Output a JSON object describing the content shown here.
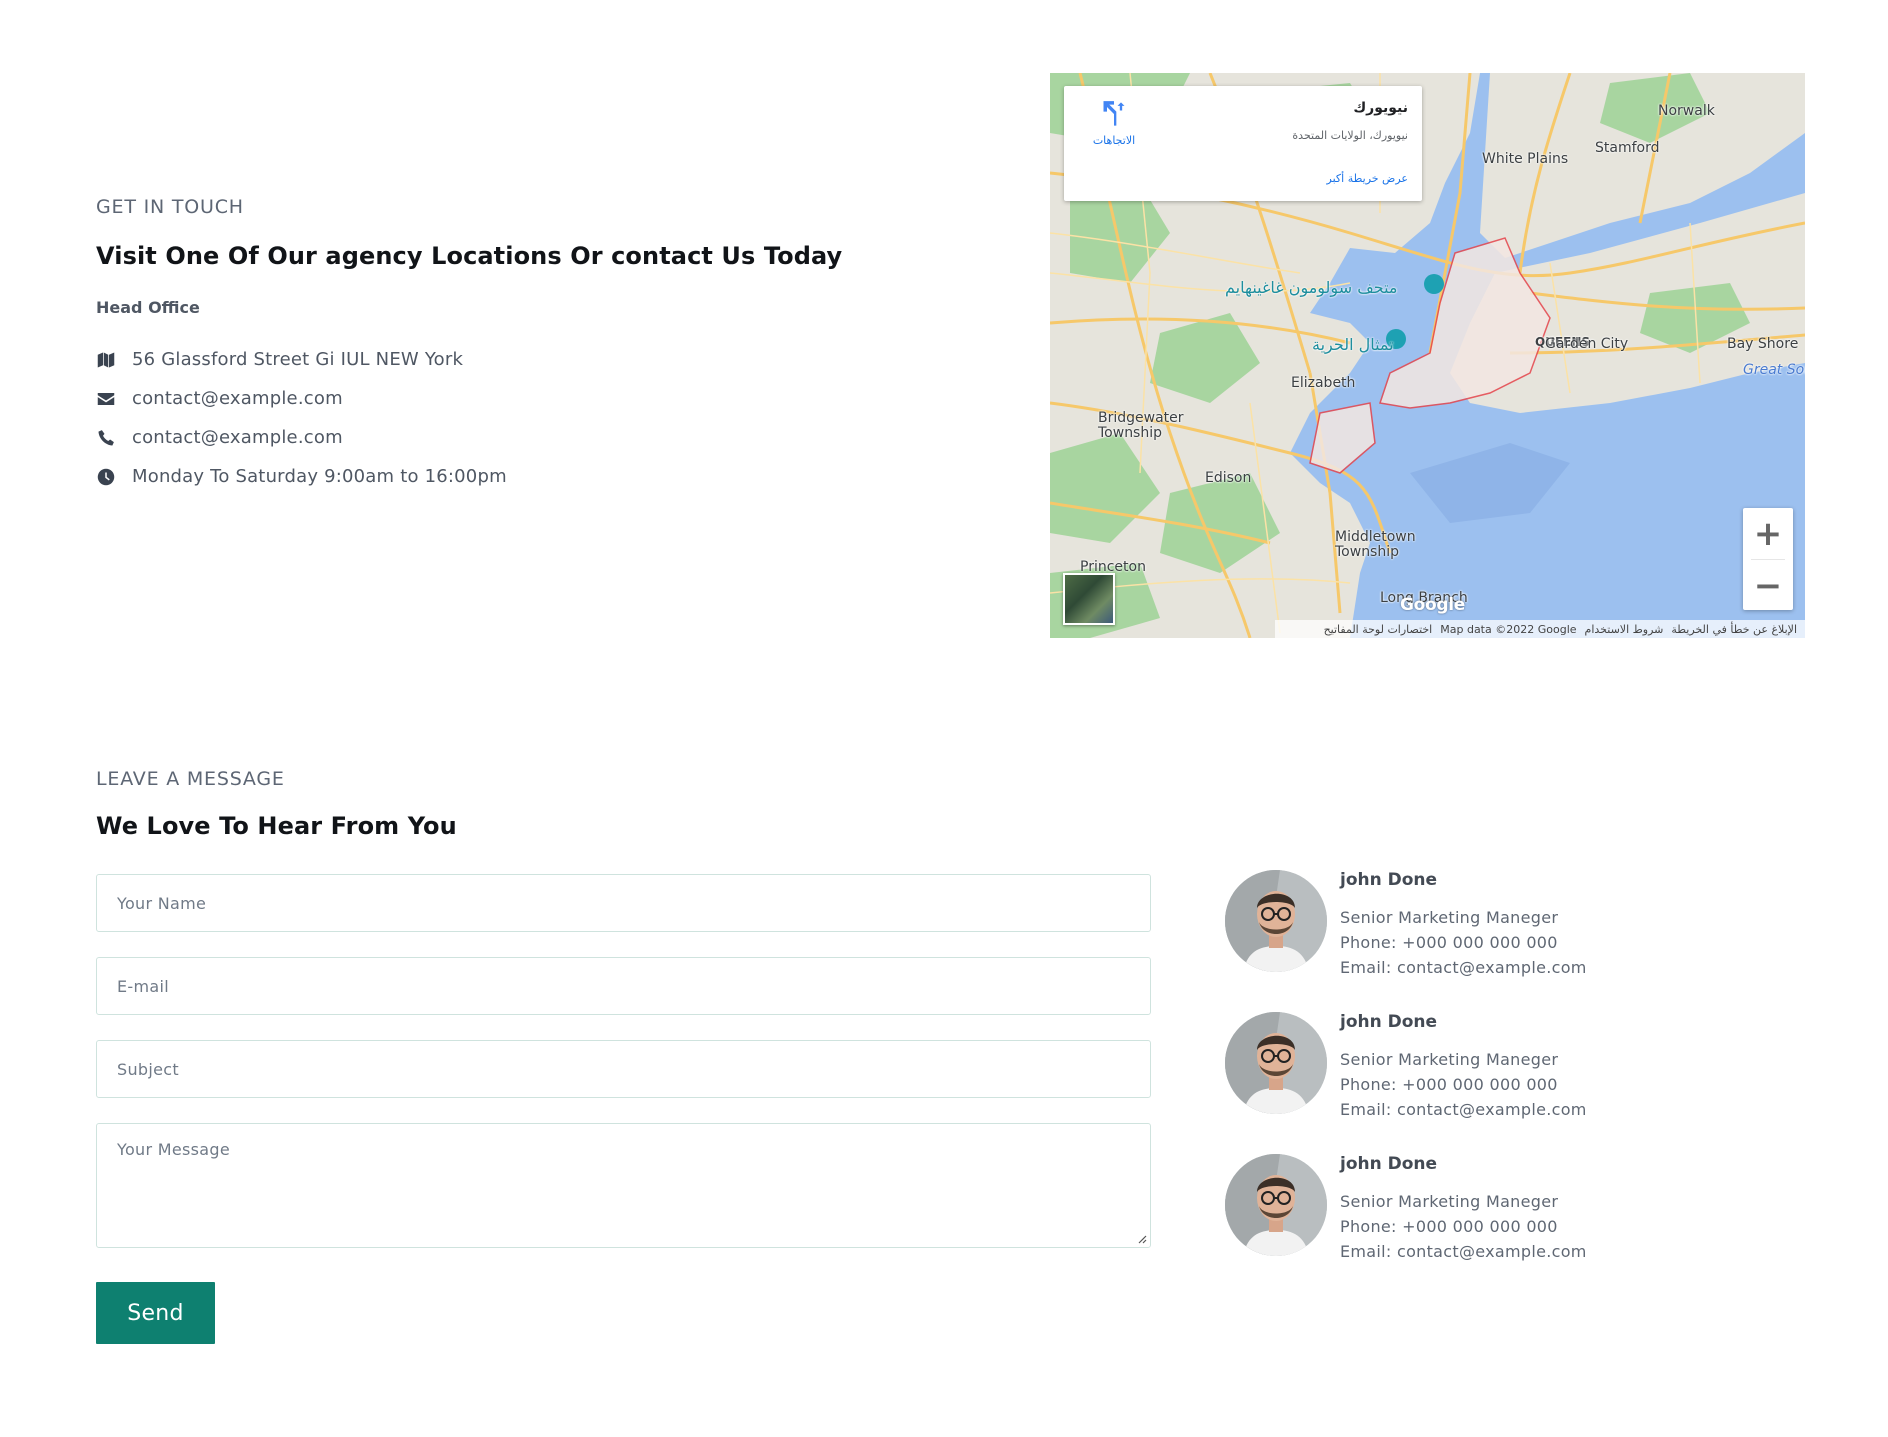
{
  "touch": {
    "kicker": "GET IN TOUCH",
    "heading": "Visit One Of Our agency Locations Or contact Us Today",
    "subhead": "Head Office",
    "items": [
      {
        "icon": "map-icon",
        "text": "56 Glassford Street Gi IUL NEW York"
      },
      {
        "icon": "envelope-icon",
        "text": "contact@example.com"
      },
      {
        "icon": "phone-icon",
        "text": "contact@example.com"
      },
      {
        "icon": "clock-icon",
        "text": "Monday To Saturday 9:00am to 16:00pm"
      }
    ]
  },
  "map": {
    "place_name": "نيويورك",
    "place_address": "نيويورك، الولايات المتحدة",
    "bigger_map_link": "عرض خريطة أكبر",
    "directions_label": "الاتجاهات",
    "zoom_in": "+",
    "zoom_out": "−",
    "attribution": {
      "shortcuts": "اختصارات لوحة المفاتيح",
      "map_data": "Map data ©2022 Google",
      "terms": "شروط الاستخدام",
      "report": "الإبلاغ عن خطأ في الخريطة"
    },
    "google_logo": "Google",
    "labels": {
      "norwalk": "Norwalk",
      "white_plains": "White Plains",
      "stamford": "Stamford",
      "queens": "QUEENS",
      "garden_city": "Garden City",
      "bay_shore": "Bay Shore",
      "great_south": "Great Sou",
      "elizabeth": "Elizabeth",
      "bridgewater": "Bridgewater Township",
      "edison": "Edison",
      "middletown": "Middletown Township",
      "princeton": "Princeton",
      "long_branch": "Long Branch",
      "museum": "متحف سولومون غاغينهايم",
      "liberty": "تمثال الحرية"
    }
  },
  "message": {
    "kicker": "LEAVE A MESSAGE",
    "heading": "We Love To Hear From You",
    "name_placeholder": "Your Name",
    "email_placeholder": "E-mail",
    "subject_placeholder": "Subject",
    "message_placeholder": "Your Message",
    "send_label": "Send"
  },
  "contacts": [
    {
      "name": "john Done",
      "role": "Senior Marketing Maneger",
      "phone": "Phone: +000 000 000 000",
      "email": "Email: contact@example.com"
    },
    {
      "name": "john Done",
      "role": "Senior Marketing Maneger",
      "phone": "Phone: +000 000 000 000",
      "email": "Email: contact@example.com"
    },
    {
      "name": "john Done",
      "role": "Senior Marketing Maneger",
      "phone": "Phone: +000 000 000 000",
      "email": "Email: contact@example.com"
    }
  ],
  "colors": {
    "accent": "#0e8070",
    "heading": "#111418",
    "body_text": "#5a6270",
    "input_border": "#cfe3de"
  }
}
